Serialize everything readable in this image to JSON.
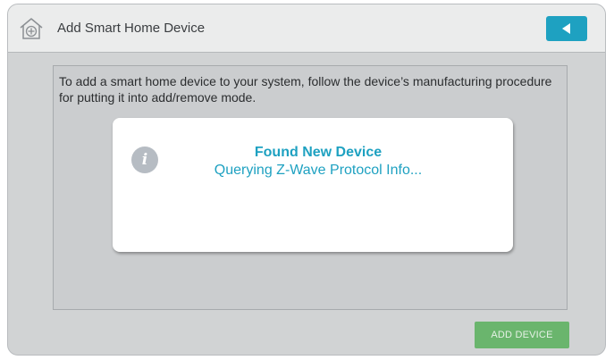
{
  "header": {
    "icon": "home-icon",
    "title": "Add Smart Home Device",
    "back_icon": "back-arrow-icon"
  },
  "main": {
    "instructions": "To add a smart home device to your system, follow the device’s manufacturing procedure for putting it into add/remove mode."
  },
  "dialog": {
    "icon": "info-icon",
    "icon_glyph": "i",
    "title": "Found New Device",
    "message": "Querying Z-Wave Protocol Info..."
  },
  "footer": {
    "add_device_label": "ADD DEVICE"
  },
  "colors": {
    "accent": "#1ea1c1",
    "add_button": "#6ab56d",
    "background": "#d1d3d4",
    "header": "#ebecec"
  }
}
